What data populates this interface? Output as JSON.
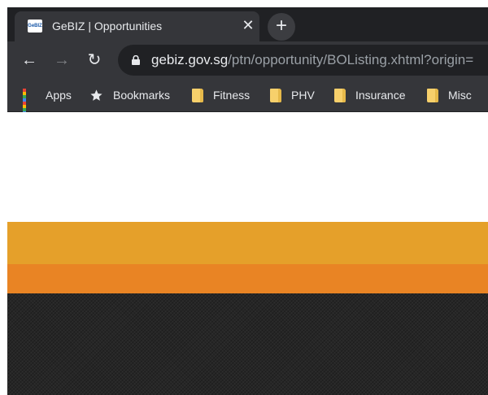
{
  "browser": {
    "tab": {
      "favicon_text": "GeBIZ",
      "title": "GeBIZ | Opportunities",
      "close_symbol": "✕"
    },
    "new_tab_symbol": "+",
    "nav": {
      "back_symbol": "←",
      "forward_symbol": "→",
      "reload_symbol": "↻"
    },
    "address": {
      "host": "gebiz.gov.sg",
      "path": "/ptn/opportunity/BOListing.xhtml?origin="
    },
    "bookmarks": [
      {
        "label": "Apps",
        "icon": "apps-grid-icon"
      },
      {
        "label": "Bookmarks",
        "icon": "star-icon"
      },
      {
        "label": "Fitness",
        "icon": "folder-icon"
      },
      {
        "label": "PHV",
        "icon": "folder-icon"
      },
      {
        "label": "Insurance",
        "icon": "folder-icon"
      },
      {
        "label": "Misc",
        "icon": "folder-icon"
      }
    ]
  },
  "colors": {
    "band_yellow": "#e5a02a",
    "band_orange": "#e98424",
    "band_dark": "#262626"
  }
}
